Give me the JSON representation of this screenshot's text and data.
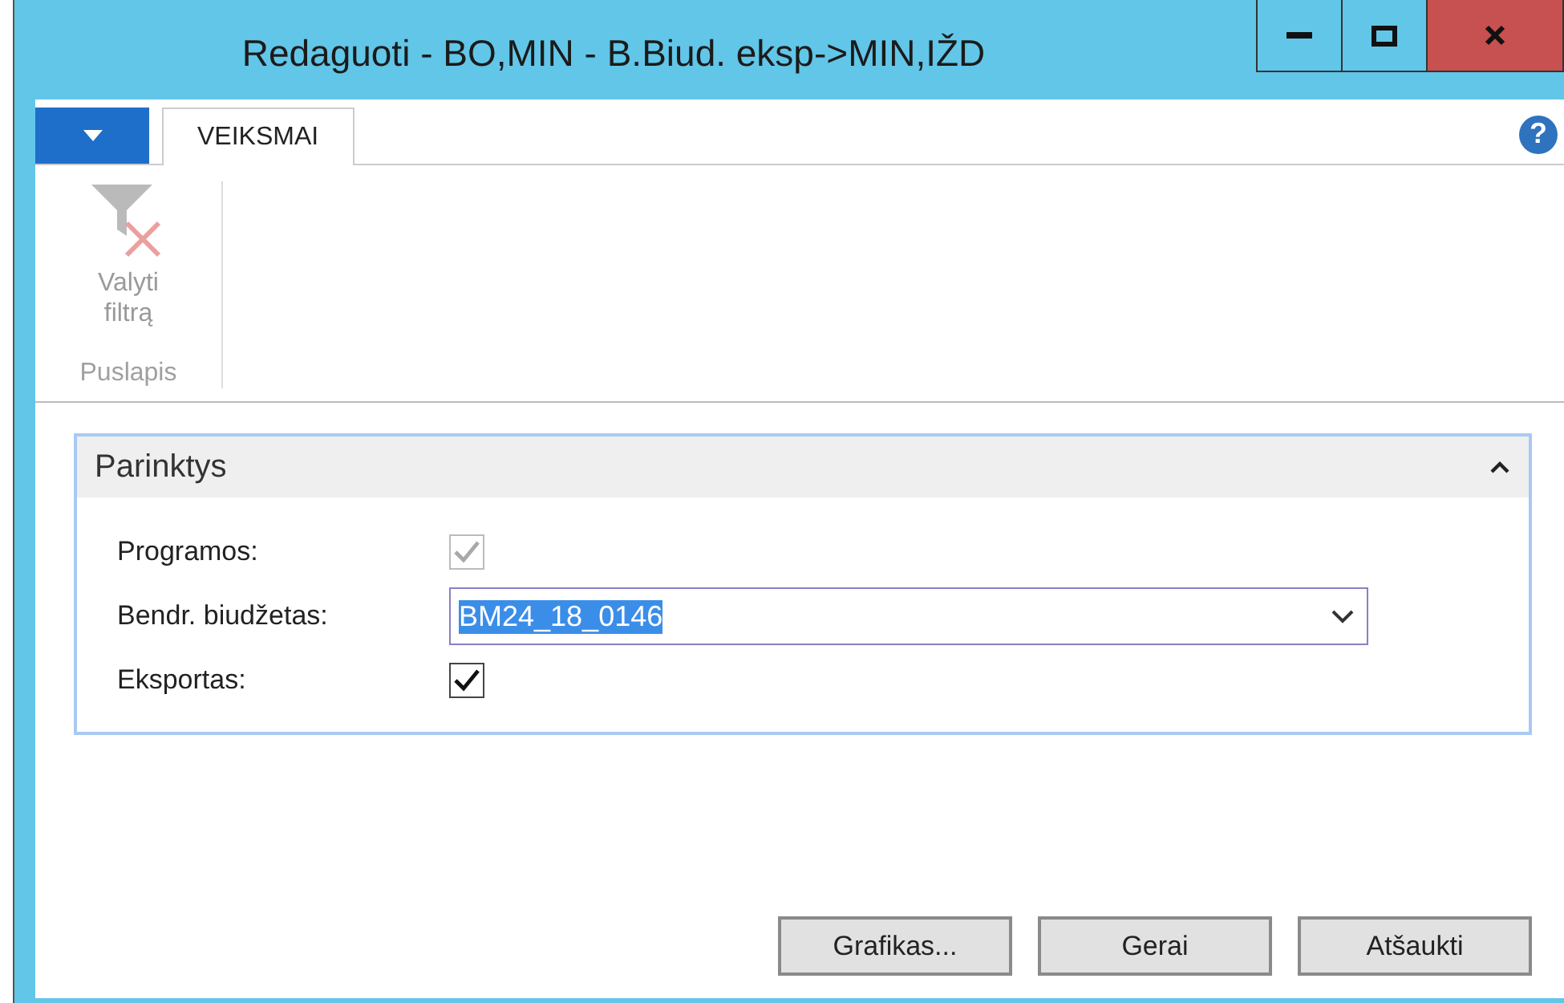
{
  "window": {
    "title": "Redaguoti - BO,MIN - B.Biud. eksp->MIN,IŽD"
  },
  "ribbon": {
    "tabs": [
      {
        "label": "VEIKSMAI",
        "selected": true
      }
    ],
    "help": "?",
    "actions": [
      {
        "label": "Valyti filtrą",
        "disabled": true
      }
    ],
    "group": "Puslapis"
  },
  "panel": {
    "title": "Parinktys",
    "expanded": true,
    "fields": [
      {
        "kind": "checkbox",
        "label": "Programos:",
        "checked": true,
        "disabled": true
      },
      {
        "kind": "dropdown",
        "label": "Bendr. biudžetas:",
        "value": "BM24_18_0146",
        "focused": true
      },
      {
        "kind": "checkbox",
        "label": "Eksportas:",
        "checked": true,
        "disabled": false
      }
    ]
  },
  "buttons": [
    "Grafikas...",
    "Gerai",
    "Atšaukti"
  ]
}
